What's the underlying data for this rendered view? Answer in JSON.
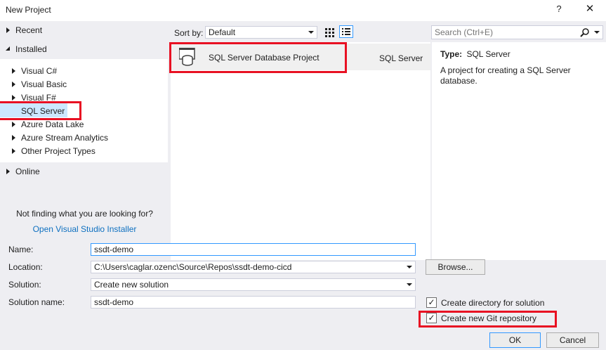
{
  "window": {
    "title": "New Project",
    "help_label": "?",
    "close_label": "✕"
  },
  "tree": {
    "recent": "Recent",
    "installed": "Installed",
    "items": [
      {
        "label": "Visual C#"
      },
      {
        "label": "Visual Basic"
      },
      {
        "label": "Visual F#"
      },
      {
        "label": "SQL Server"
      },
      {
        "label": "Azure Data Lake"
      },
      {
        "label": "Azure Stream Analytics"
      },
      {
        "label": "Other Project Types"
      }
    ],
    "online": "Online",
    "hint": "Not finding what you are looking for?",
    "installer_link": "Open Visual Studio Installer"
  },
  "toolbar": {
    "sort_label": "Sort by:",
    "sort_value": "Default"
  },
  "search": {
    "placeholder": "Search (Ctrl+E)"
  },
  "templates": [
    {
      "name": "SQL Server Database Project",
      "language": "SQL Server"
    }
  ],
  "info": {
    "type_label": "Type:",
    "type_value": "SQL Server",
    "description": "A project for creating a SQL Server database."
  },
  "form": {
    "name_label": "Name:",
    "name_value": "ssdt-demo",
    "location_label": "Location:",
    "location_value": "C:\\Users\\caglar.ozenc\\Source\\Repos\\ssdt-demo-cicd",
    "browse_label": "Browse...",
    "solution_label": "Solution:",
    "solution_value": "Create new solution",
    "solution_name_label": "Solution name:",
    "solution_name_value": "ssdt-demo",
    "create_dir_label": "Create directory for solution",
    "create_git_label": "Create new Git repository",
    "check_mark": "✓",
    "ok_label": "OK",
    "cancel_label": "Cancel"
  }
}
